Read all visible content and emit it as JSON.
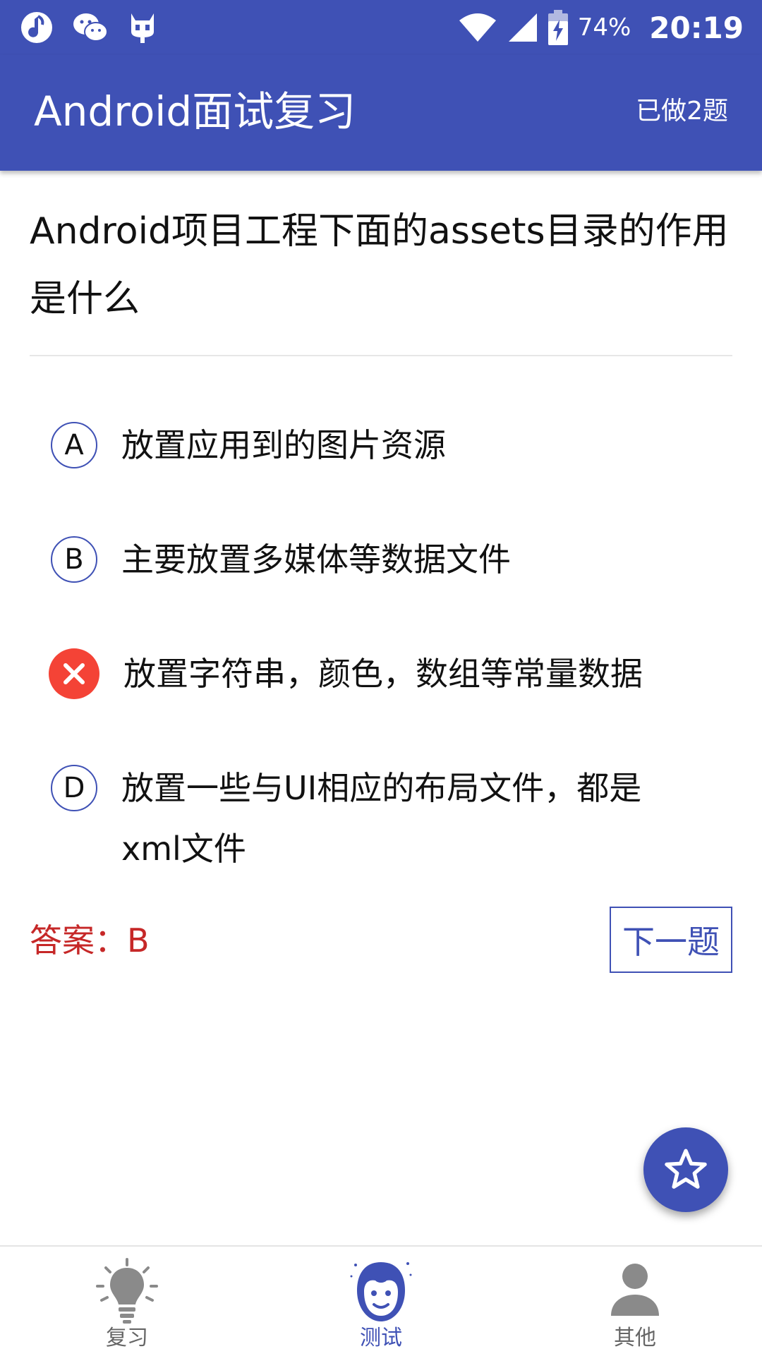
{
  "status_bar": {
    "battery_percent": "74%",
    "time": "20:19",
    "left_icons": [
      "music-app-icon",
      "wechat-icon",
      "cyanogen-bot-icon"
    ],
    "right_icons": [
      "wifi-icon",
      "cell-signal-icon",
      "battery-charging-icon"
    ]
  },
  "toolbar": {
    "title": "Android面试复习",
    "done_count": "已做2题"
  },
  "question": {
    "text": "Android项目工程下面的assets目录的作用是什么"
  },
  "options": [
    {
      "letter": "A",
      "text": "放置应用到的图片资源",
      "state": "normal"
    },
    {
      "letter": "B",
      "text": "主要放置多媒体等数据文件",
      "state": "normal"
    },
    {
      "letter": "C",
      "text": "放置字符串，颜色，数组等常量数据",
      "state": "wrong"
    },
    {
      "letter": "D",
      "text": "放置一些与UI相应的布局文件，都是xml文件",
      "state": "normal"
    }
  ],
  "answer": {
    "text": "答案：B"
  },
  "next_button": {
    "label": "下一题"
  },
  "fab": {
    "icon": "star-outline-icon"
  },
  "bottom_nav": {
    "items": [
      {
        "label": "复习",
        "icon": "lightbulb-icon",
        "active": false
      },
      {
        "label": "测试",
        "icon": "face-icon",
        "active": true
      },
      {
        "label": "其他",
        "icon": "person-icon",
        "active": false
      }
    ]
  },
  "colors": {
    "primary": "#3f51b5",
    "wrong": "#f44336",
    "answer": "#c62828",
    "inactive": "#8a8a8a"
  }
}
